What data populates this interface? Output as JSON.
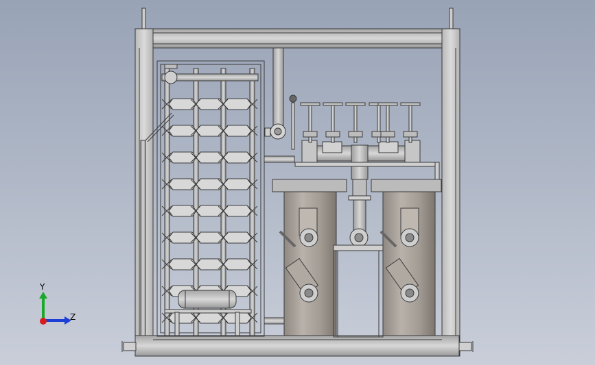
{
  "viewport": {
    "background_top": "#98a3b6",
    "background_bottom": "#c9ced9"
  },
  "model": {
    "frame_color": "#c8c8c8",
    "metal_color": "#a9a29b",
    "edge_color": "#3a3a3a",
    "left_rack_unit_rows": 9,
    "left_rack_unit_cols": 3,
    "vessels": 2,
    "top_handwheels": 6
  },
  "triad": {
    "y_label": "Y",
    "z_label": "Z",
    "y_color": "#18a82a",
    "z_color": "#1c3fd6",
    "x_color": "#d61c1c"
  }
}
